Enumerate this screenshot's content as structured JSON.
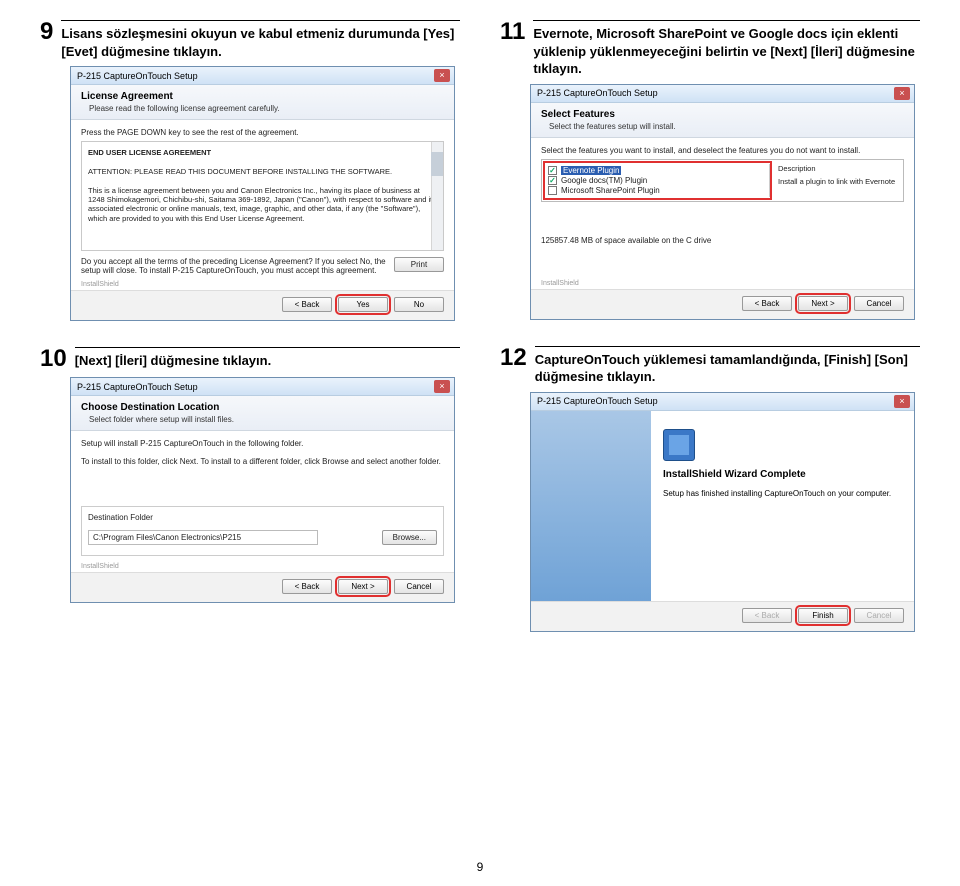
{
  "page_number": "9",
  "step9": {
    "num": "9",
    "title": "Lisans sözleşmesini okuyun ve kabul etmeniz durumunda [Yes] [Evet] düğmesine tıklayın.",
    "dialog_title": "P-215 CaptureOnTouch Setup",
    "head": "License Agreement",
    "sub": "Please read the following license agreement carefully.",
    "note": "Press the PAGE DOWN key to see the rest of the agreement.",
    "eula_title": "END USER LICENSE AGREEMENT",
    "eula_att": "ATTENTION: PLEASE READ THIS DOCUMENT BEFORE INSTALLING THE SOFTWARE.",
    "eula_body": "This is a license agreement between you and Canon Electronics Inc., having its place of business at 1248 Shimokagemori, Chichibu-shi, Saitama 369-1892, Japan (\"Canon\"), with respect to software and its associated electronic or online manuals, text, image, graphic, and other data, if any (the \"Software\"), which are provided to you with this End User License Agreement.",
    "q": "Do you accept all the terms of the preceding License Agreement? If you select No, the setup will close. To install P-215 CaptureOnTouch, you must accept this agreement.",
    "ishield": "InstallShield",
    "btn_back": "< Back",
    "btn_yes": "Yes",
    "btn_no": "No",
    "btn_print": "Print"
  },
  "step10": {
    "num": "10",
    "title": "[Next] [İleri] düğmesine tıklayın.",
    "dialog_title": "P-215 CaptureOnTouch Setup",
    "head": "Choose Destination Location",
    "sub": "Select folder where setup will install files.",
    "l1": "Setup will install P-215 CaptureOnTouch in the following folder.",
    "l2": "To install to this folder, click Next. To install to a different folder, click Browse and select another folder.",
    "dest_label": "Destination Folder",
    "dest": "C:\\Program Files\\Canon Electronics\\P215",
    "browse": "Browse...",
    "ishield": "InstallShield",
    "btn_back": "< Back",
    "btn_next": "Next >",
    "btn_cancel": "Cancel"
  },
  "step11": {
    "num": "11",
    "title": "Evernote, Microsoft SharePoint ve Google docs için eklenti yüklenip yüklenmeyeceğini belirtin ve [Next] [İleri] düğmesine tıklayın.",
    "dialog_title": "P-215 CaptureOnTouch Setup",
    "head": "Select Features",
    "sub": "Select the features setup will install.",
    "bodyline": "Select the features you want to install, and deselect the features you do not want to install.",
    "f1": "Evernote Plugin",
    "f2": "Google docs(TM) Plugin",
    "f3": "Microsoft SharePoint Plugin",
    "desc_h": "Description",
    "desc": "Install a plugin to link with Evernote",
    "space": "125857.48 MB of space available on the C drive",
    "ishield": "InstallShield",
    "btn_back": "< Back",
    "btn_next": "Next >",
    "btn_cancel": "Cancel"
  },
  "step12": {
    "num": "12",
    "title": "CaptureOnTouch yüklemesi tamamlandığında, [Finish] [Son] düğmesine tıklayın.",
    "dialog_title": "P-215 CaptureOnTouch Setup",
    "h": "InstallShield Wizard Complete",
    "body": "Setup has finished installing CaptureOnTouch on your computer.",
    "btn_back": "< Back",
    "btn_finish": "Finish",
    "btn_cancel": "Cancel"
  }
}
